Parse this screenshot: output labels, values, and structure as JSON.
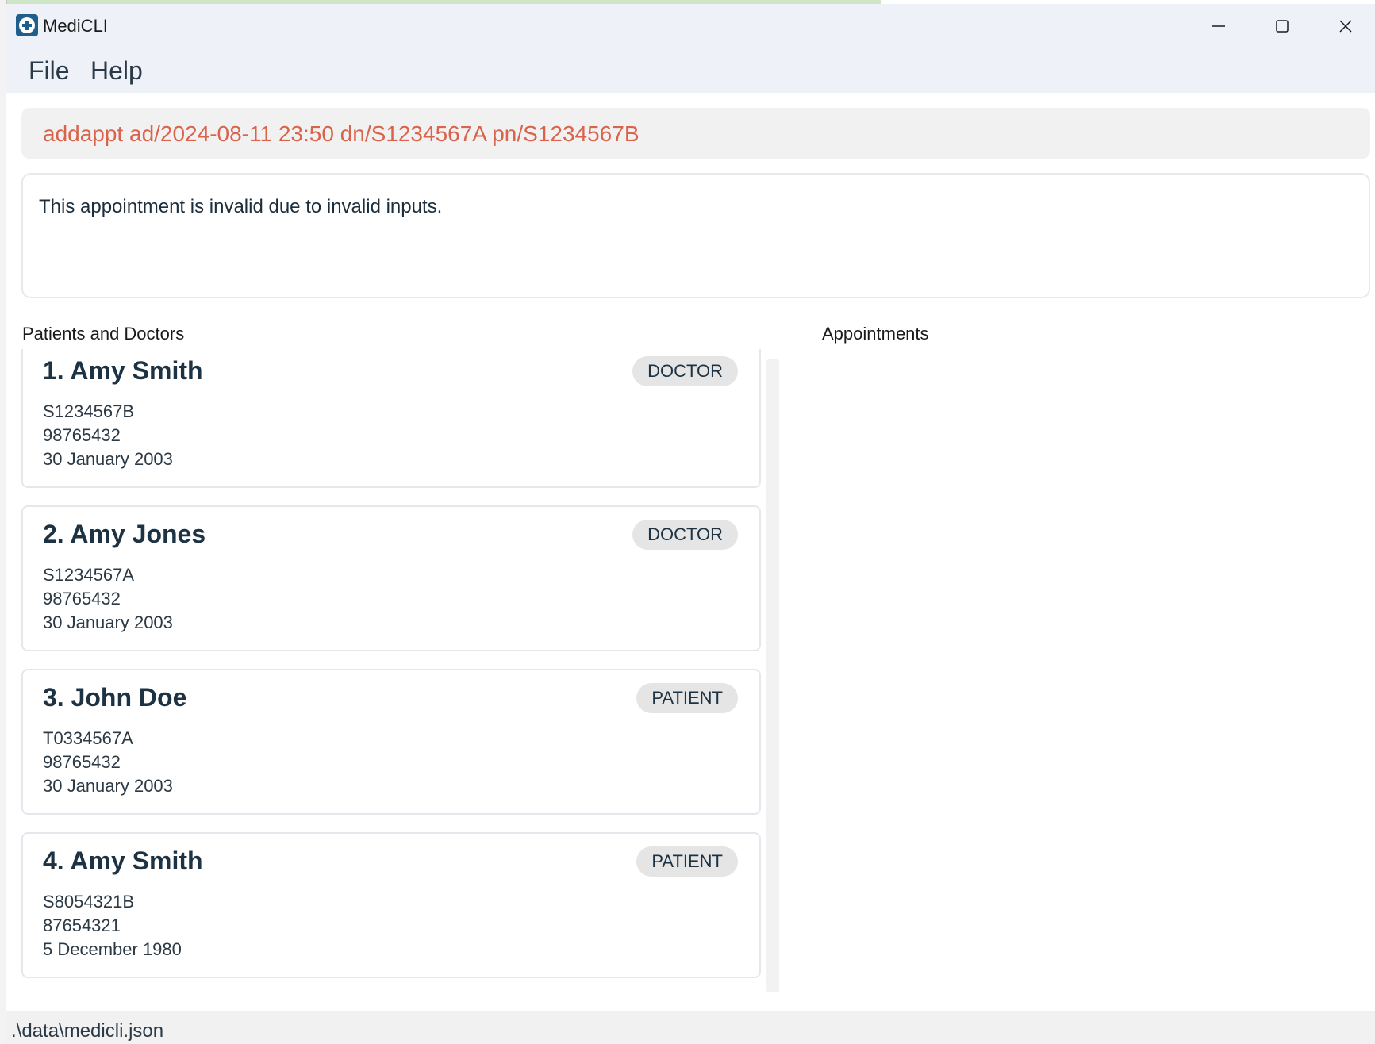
{
  "window": {
    "title": "MediCLI"
  },
  "menu": {
    "file": "File",
    "help": "Help"
  },
  "command": {
    "text": "addappt ad/2024-08-11 23:50 dn/S1234567A pn/S1234567B"
  },
  "result": {
    "message": "This appointment is invalid due to invalid inputs."
  },
  "panels": {
    "people_label": "Patients and Doctors",
    "appointments_label": "Appointments"
  },
  "people": [
    {
      "title": "1.  Amy Smith",
      "role": "DOCTOR",
      "nric": "S1234567B",
      "phone": "98765432",
      "dob": "30 January 2003"
    },
    {
      "title": "2.  Amy Jones",
      "role": "DOCTOR",
      "nric": "S1234567A",
      "phone": "98765432",
      "dob": "30 January 2003"
    },
    {
      "title": "3.  John Doe",
      "role": "PATIENT",
      "nric": "T0334567A",
      "phone": "98765432",
      "dob": "30 January 2003"
    },
    {
      "title": "4.  Amy Smith",
      "role": "PATIENT",
      "nric": "S8054321B",
      "phone": "87654321",
      "dob": "5 December 1980"
    }
  ],
  "appointments": [],
  "status": {
    "file_path": ".\\data\\medicli.json"
  },
  "colors": {
    "command_error": "#d9634b",
    "title_text": "#1d3343",
    "badge_bg": "#e5e5e5",
    "titlebar_bg": "#eef1f8"
  }
}
